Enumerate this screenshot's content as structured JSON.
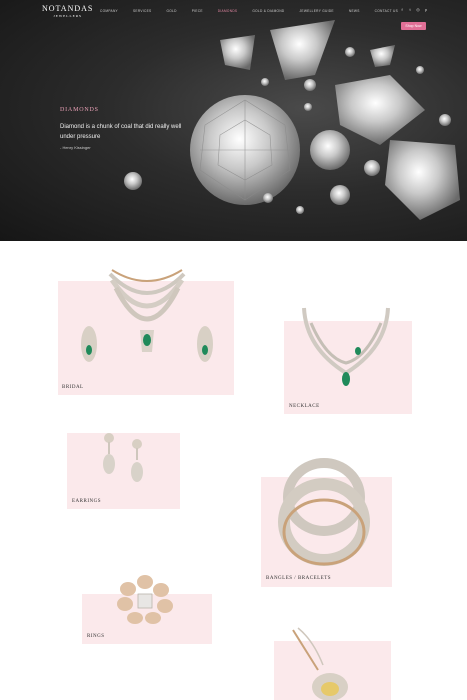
{
  "header": {
    "logo_line1": "NOTANDAS",
    "logo_line2": "JEWELLERS",
    "nav": [
      "COMPANY",
      "SERVICES",
      "GOLD",
      "PIECE",
      "DIAMONDS",
      "GOLD & DIAMOND",
      "JEWELLERY GUIDE",
      "NEWS",
      "CONTACT US"
    ],
    "active_nav_index": 4,
    "social_icons": [
      "facebook-icon",
      "twitter-icon",
      "instagram-icon",
      "pinterest-icon"
    ],
    "shop_now_label": "Shop Now"
  },
  "hero": {
    "title": "DIAMONDS",
    "quote": "Diamond is a chunk of coal that did really well under pressure",
    "author": "- Henry Kissinger"
  },
  "categories": [
    {
      "label": "BRIDAL"
    },
    {
      "label": "NECKLACE"
    },
    {
      "label": "EARRINGS"
    },
    {
      "label": "BANGLES / BRACELETS"
    },
    {
      "label": "RINGS"
    },
    {
      "label": ""
    }
  ],
  "colors": {
    "accent_pink": "#e06f96",
    "card_bg": "#fbe9eb",
    "hero_bg": "#2c2c2c"
  }
}
